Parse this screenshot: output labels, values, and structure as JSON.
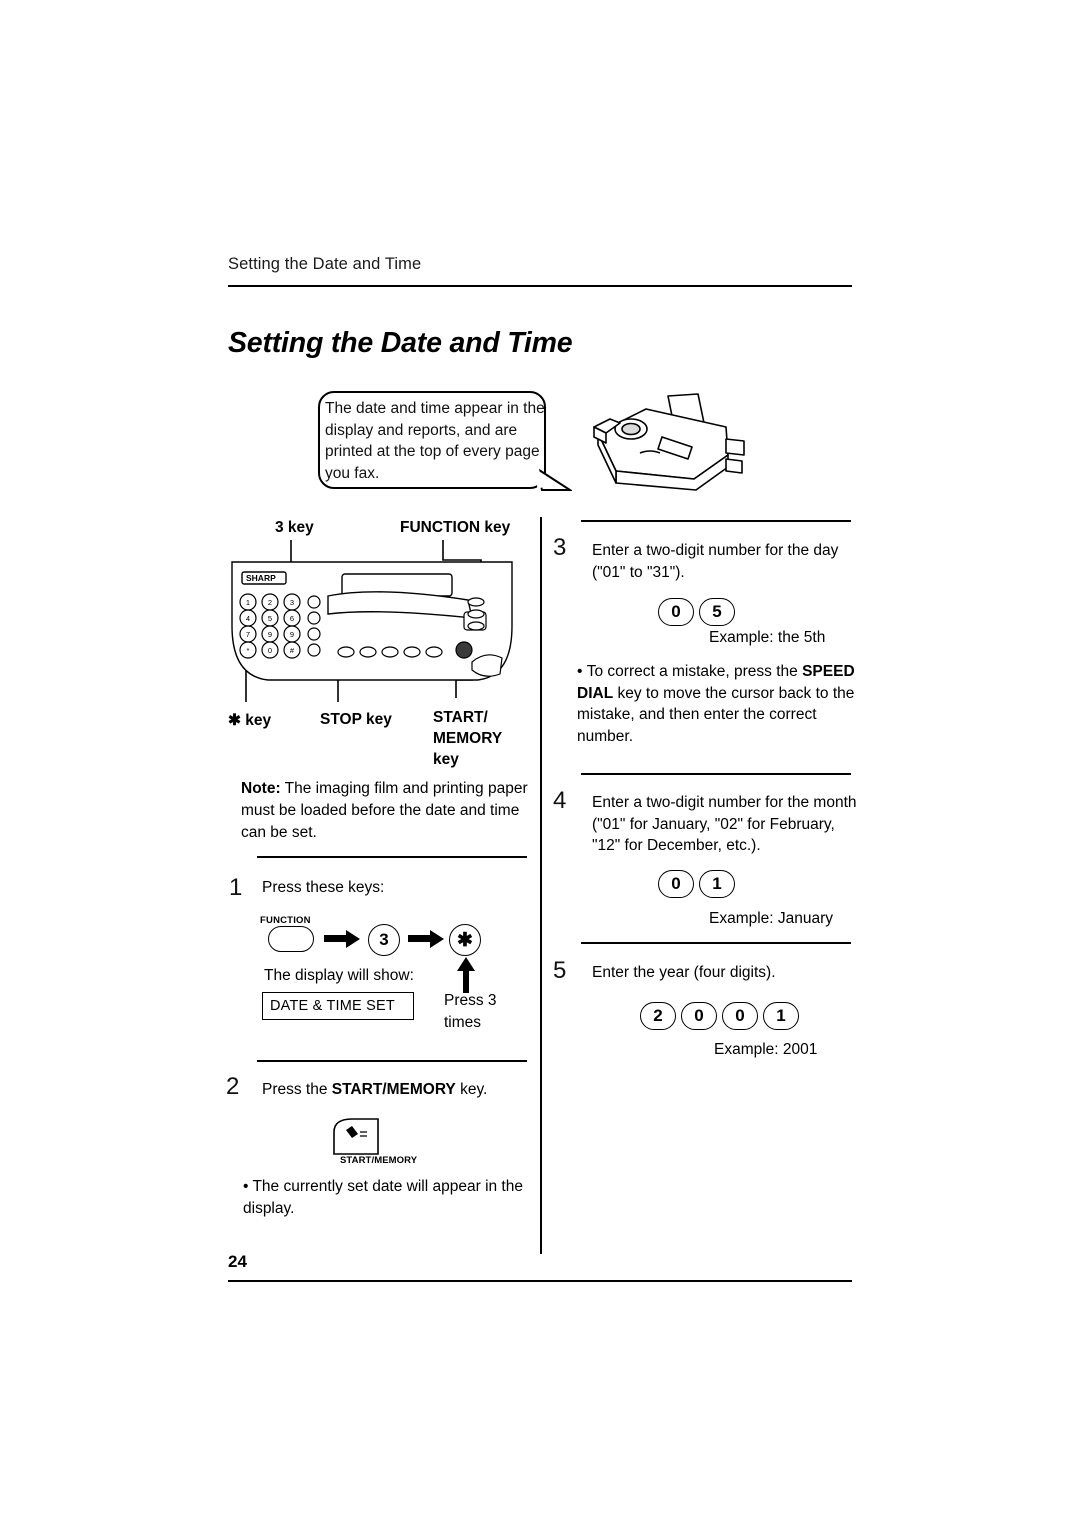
{
  "document": {
    "running_header": "Setting the Date and Time",
    "title": "Setting the Date and Time",
    "page_number": "24"
  },
  "bubble": {
    "text": "The date and time appear in the display and reports, and are printed at the top of every page you fax."
  },
  "diagram_labels": {
    "three_key": "3 key",
    "function_key": "FUNCTION key",
    "star_key": "✱ key",
    "stop_key": "STOP key",
    "start_memory_key_line1": "START/",
    "start_memory_key_line2": "MEMORY",
    "start_memory_key_line3": "key",
    "fax_brand": "SHARP"
  },
  "note": {
    "label": "Note:",
    "text": " The imaging film and printing paper must be loaded before the date and time can be set."
  },
  "left_steps": [
    {
      "number": "1",
      "text": "Press these keys:",
      "function_caption": "FUNCTION",
      "key_3": "3",
      "key_star": "✱",
      "display_will_show": "The display will show:",
      "lcd_text": "DATE & TIME SET",
      "press_times_line1": "Press 3",
      "press_times_line2": "times"
    },
    {
      "number": "2",
      "text_before": "Press the ",
      "text_bold": "START/MEMORY",
      "text_after": " key.",
      "key_caption": "START/MEMORY",
      "bullet": "The currently set date will appear in the display."
    }
  ],
  "right_steps": [
    {
      "number": "3",
      "text": "Enter a two-digit number for the day (\"01\" to \"31\").",
      "keys": [
        "0",
        "5"
      ],
      "example": "Example: the 5th",
      "bullet_before": "To correct a mistake, press the ",
      "bullet_bold": "SPEED DIAL",
      "bullet_after": " key to move the cursor back to the mistake, and then enter the correct number."
    },
    {
      "number": "4",
      "text": "Enter a two-digit number for the month (\"01\" for January, \"02\" for February, \"12\" for December, etc.).",
      "keys": [
        "0",
        "1"
      ],
      "example": "Example: January"
    },
    {
      "number": "5",
      "text": "Enter the year (four digits).",
      "keys": [
        "2",
        "0",
        "0",
        "1"
      ],
      "example": "Example: 2001"
    }
  ],
  "colors": {
    "ink": "#000000",
    "text": "#111111",
    "paper": "#ffffff"
  }
}
